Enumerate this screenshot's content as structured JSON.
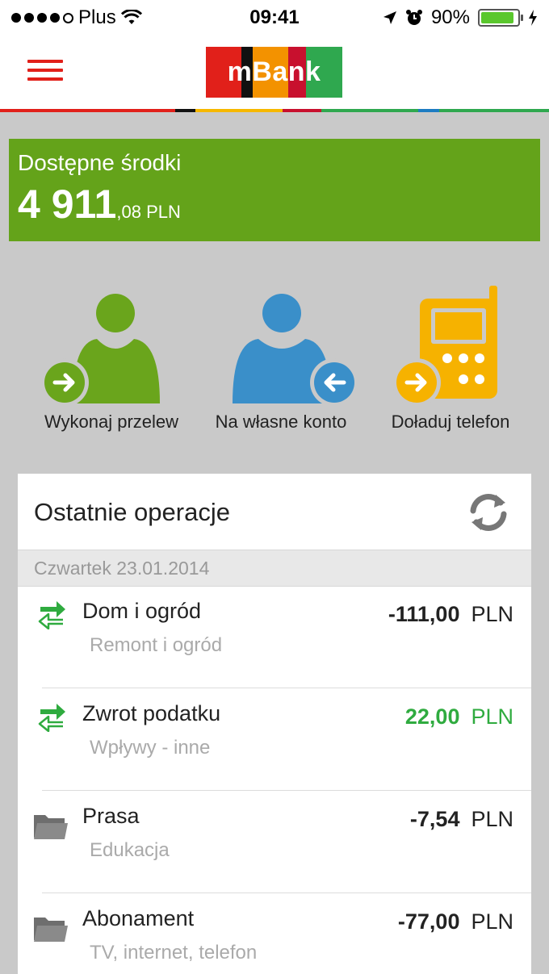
{
  "status_bar": {
    "carrier": "Plus",
    "time": "09:41",
    "battery": "90%",
    "battery_level": 0.9
  },
  "header": {
    "logo_text": "mBank",
    "logo_colors": [
      "#e1201a",
      "#111111",
      "#f39200",
      "#c8102e",
      "#2fa84f"
    ],
    "stripe_colors": [
      "#e1201a",
      "#111111",
      "#f6b800",
      "#c8102e",
      "#2fa84f",
      "#1d7cc2",
      "#2fa84f"
    ]
  },
  "balance": {
    "label": "Dostępne środki",
    "amount_int": "4 911",
    "amount_dec": ",08 PLN"
  },
  "actions": [
    {
      "label": "Wykonaj przelew",
      "icon": "person-arrow-right-icon",
      "color": "#6aa51c"
    },
    {
      "label": "Na własne konto",
      "icon": "person-arrow-left-icon",
      "color": "#3a8fc9"
    },
    {
      "label": "Doładuj telefon",
      "icon": "phone-topup-icon",
      "color": "#f6b200"
    }
  ],
  "operations": {
    "title": "Ostatnie operacje",
    "date": "Czwartek 23.01.2014",
    "items": [
      {
        "title": "Dom i ogród",
        "category": "Remont i ogród",
        "amount": "-111,00",
        "currency": "PLN",
        "icon": "transfer-icon",
        "positive": false
      },
      {
        "title": "Zwrot podatku",
        "category": "Wpływy - inne",
        "amount": "22,00",
        "currency": "PLN",
        "icon": "transfer-icon",
        "positive": true
      },
      {
        "title": "Prasa",
        "category": "Edukacja",
        "amount": "-7,54",
        "currency": "PLN",
        "icon": "folder-icon",
        "positive": false
      },
      {
        "title": "Abonament",
        "category": "TV, internet, telefon",
        "amount": "-77,00",
        "currency": "PLN",
        "icon": "folder-icon",
        "positive": false
      }
    ]
  }
}
